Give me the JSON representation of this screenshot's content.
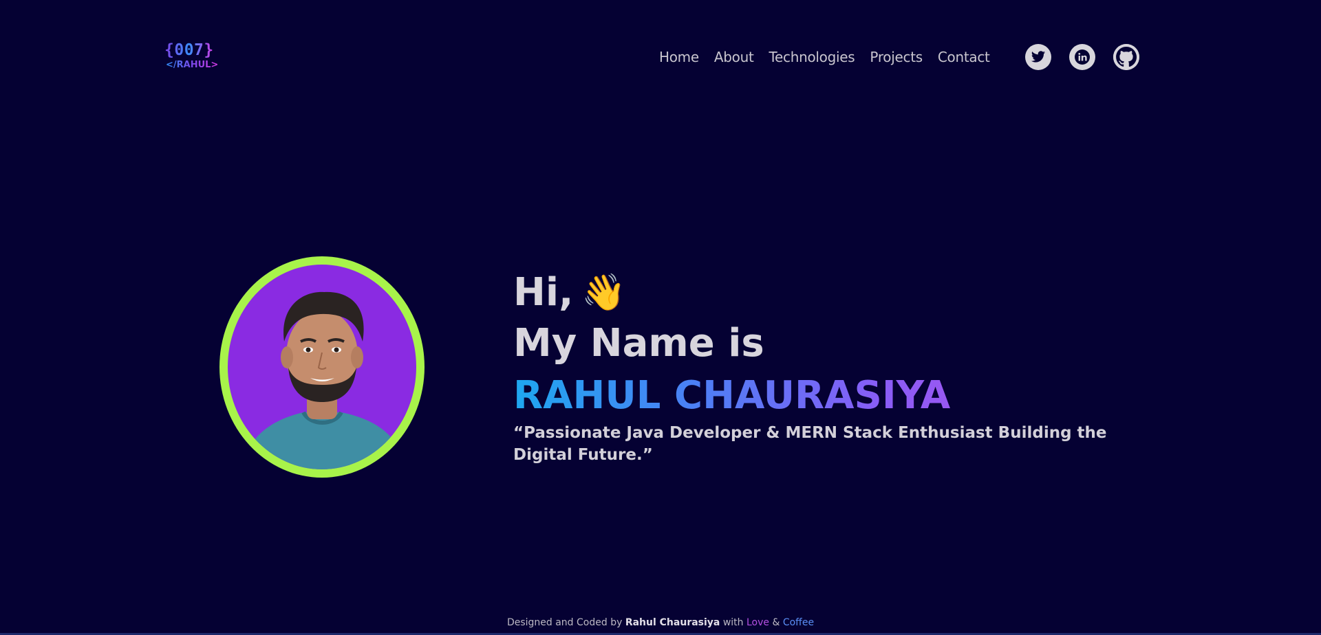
{
  "logo": {
    "top": "{007}",
    "bottom": "</RAHUL>"
  },
  "nav": {
    "items": [
      {
        "label": "Home"
      },
      {
        "label": "About"
      },
      {
        "label": "Technologies"
      },
      {
        "label": "Projects"
      },
      {
        "label": "Contact"
      }
    ]
  },
  "social": [
    {
      "icon": "twitter-icon"
    },
    {
      "icon": "linkedin-icon"
    },
    {
      "icon": "github-icon"
    }
  ],
  "hero": {
    "greeting": "Hi,",
    "wave_emoji": "👋",
    "intro": "My Name is",
    "name": "RAHUL CHAURASIYA",
    "tagline": "“Passionate Java Developer & MERN Stack Enthusiast Building the Digital Future.”",
    "avatar_ring_color": "#a8f34a",
    "avatar_bg_color": "#8a2be2"
  },
  "footer": {
    "prefix": "Designed and Coded by",
    "author": "Rahul Chaurasiya",
    "with": "with",
    "love": "Love",
    "amp": "&",
    "coffee": "Coffee"
  },
  "colors": {
    "background": "#050133",
    "text": "#d8d5dd",
    "gradient_start": "#1ea7f0",
    "gradient_end": "#c04ee8"
  }
}
